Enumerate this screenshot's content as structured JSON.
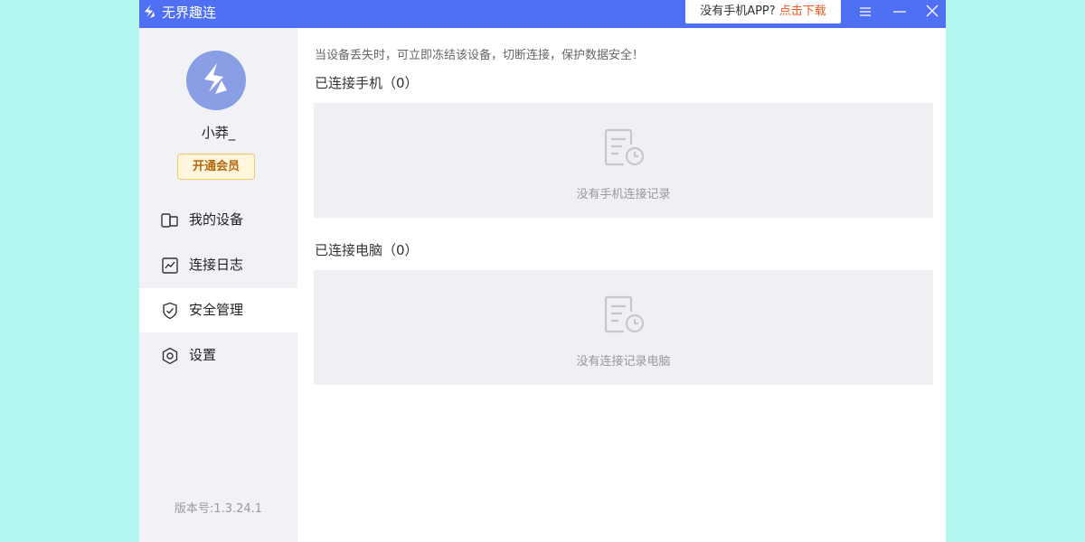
{
  "app": {
    "title": "无界趣连"
  },
  "titlebar": {
    "promo_question": "没有手机APP? ",
    "promo_link": "点击下载"
  },
  "user": {
    "name": "小莽_",
    "vip_button": "开通会员"
  },
  "sidebar": {
    "items": [
      {
        "label": "我的设备",
        "icon": "device-icon",
        "active": false
      },
      {
        "label": "连接日志",
        "icon": "log-chart-icon",
        "active": false
      },
      {
        "label": "安全管理",
        "icon": "shield-check-icon",
        "active": true
      },
      {
        "label": "设置",
        "icon": "gear-icon",
        "active": false
      }
    ],
    "version": "版本号:1.3.24.1"
  },
  "main": {
    "notice": "当设备丢失时，可立即冻结该设备，切断连接，保护数据安全！",
    "phones": {
      "title": "已连接手机（0）",
      "empty_text": "没有手机连接记录"
    },
    "computers": {
      "title": "已连接电脑（0）",
      "empty_text": "没有连接记录电脑"
    }
  },
  "colors": {
    "titlebar": "#4f70f5",
    "accent_link": "#f15a24",
    "sidebar_bg": "#f1f2f6",
    "page_bg": "#b4f7f1"
  }
}
